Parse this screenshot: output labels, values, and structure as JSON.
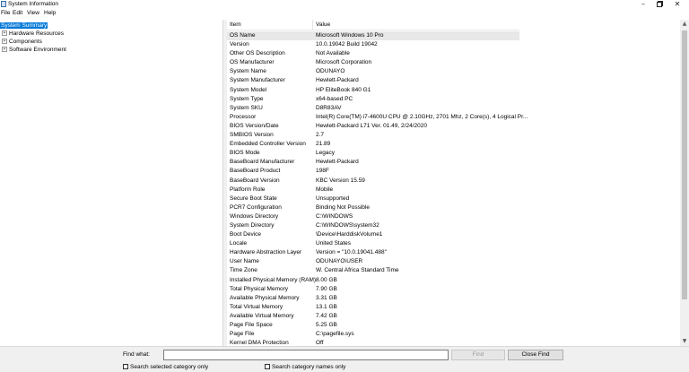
{
  "window": {
    "title": "System Information"
  },
  "menu": [
    "File",
    "Edit",
    "View",
    "Help"
  ],
  "tree": {
    "selected": "System Summary",
    "children": [
      {
        "label": "Hardware Resources",
        "expander": "+"
      },
      {
        "label": "Components",
        "expander": "+"
      },
      {
        "label": "Software Environment",
        "expander": "+"
      }
    ]
  },
  "table": {
    "columns": [
      "Item",
      "Value"
    ],
    "rows": [
      [
        "OS Name",
        "Microsoft Windows 10 Pro"
      ],
      [
        "Version",
        "10.0.19042 Build 19042"
      ],
      [
        "Other OS Description",
        "Not Available"
      ],
      [
        "OS Manufacturer",
        "Microsoft Corporation"
      ],
      [
        "System Name",
        "ODUNAYO"
      ],
      [
        "System Manufacturer",
        "Hewlett-Packard"
      ],
      [
        "System Model",
        "HP EliteBook 840 G1"
      ],
      [
        "System Type",
        "x64-based PC"
      ],
      [
        "System SKU",
        "D8R83AV"
      ],
      [
        "Processor",
        "Intel(R) Core(TM) i7-4600U CPU @ 2.10GHz, 2701 Mhz, 2 Core(s), 4 Logical Pr..."
      ],
      [
        "BIOS Version/Date",
        "Hewlett-Packard L71 Ver. 01.49, 2/24/2020"
      ],
      [
        "SMBIOS Version",
        "2.7"
      ],
      [
        "Embedded Controller Version",
        "21.89"
      ],
      [
        "BIOS Mode",
        "Legacy"
      ],
      [
        "BaseBoard Manufacturer",
        "Hewlett-Packard"
      ],
      [
        "BaseBoard Product",
        "198F"
      ],
      [
        "BaseBoard Version",
        "KBC Version 15.59"
      ],
      [
        "Platform Role",
        "Mobile"
      ],
      [
        "Secure Boot State",
        "Unsupported"
      ],
      [
        "PCR7 Configuration",
        "Binding Not Possible"
      ],
      [
        "Windows Directory",
        "C:\\WINDOWS"
      ],
      [
        "System Directory",
        "C:\\WINDOWS\\system32"
      ],
      [
        "Boot Device",
        "\\Device\\HarddiskVolume1"
      ],
      [
        "Locale",
        "United States"
      ],
      [
        "Hardware Abstraction Layer",
        "Version = \"10.0.19041.488\""
      ],
      [
        "User Name",
        "ODUNAYO\\USER"
      ],
      [
        "Time Zone",
        "W. Central Africa Standard Time"
      ],
      [
        "Installed Physical Memory (RAM)",
        "8.00 GB"
      ],
      [
        "Total Physical Memory",
        "7.90 GB"
      ],
      [
        "Available Physical Memory",
        "3.31 GB"
      ],
      [
        "Total Virtual Memory",
        "13.1 GB"
      ],
      [
        "Available Virtual Memory",
        "7.42 GB"
      ],
      [
        "Page File Space",
        "5.25 GB"
      ],
      [
        "Page File",
        "C:\\pagefile.sys"
      ],
      [
        "Kernel DMA Protection",
        "Off"
      ]
    ]
  },
  "find": {
    "label": "Find what:",
    "value": "",
    "find_button": "Find",
    "close_button": "Close Find",
    "checkbox_selected_category": "Search selected category only",
    "checkbox_category_names": "Search category names only"
  },
  "colors": {
    "selection": "#0078d7",
    "row_highlight": "#e8e8e8"
  }
}
